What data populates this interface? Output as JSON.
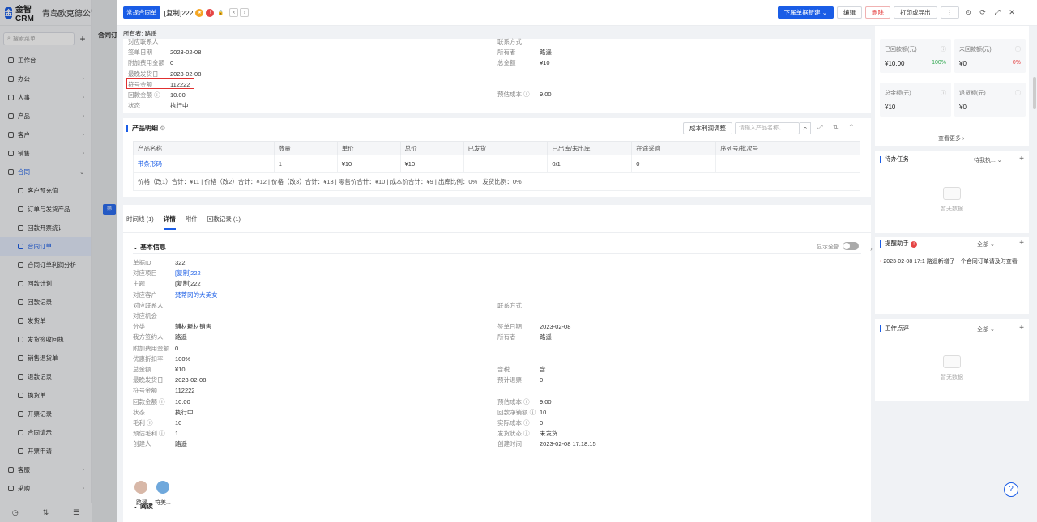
{
  "brand": {
    "logo_letter": "金",
    "name": "金智CRM",
    "company": "青岛欧克德公司"
  },
  "sidebar": {
    "search_placeholder": "搜索菜单",
    "items": [
      {
        "label": "工作台",
        "arrow": ""
      },
      {
        "label": "办公",
        "arrow": "›"
      },
      {
        "label": "人事",
        "arrow": "›"
      },
      {
        "label": "产品",
        "arrow": "›"
      },
      {
        "label": "客户",
        "arrow": "›"
      },
      {
        "label": "销售",
        "arrow": "›"
      },
      {
        "label": "合同",
        "arrow": "⌄"
      }
    ],
    "subitems": [
      "客户预充值",
      "订单与发货产品",
      "回款开票统计",
      "合同订单",
      "合同订单利润分析",
      "回款计划",
      "回款记录",
      "发货单",
      "发货签收回执",
      "销售退货单",
      "退款记录",
      "换货单",
      "开票记录",
      "合同请示",
      "开票申请"
    ],
    "active_index": 3,
    "bottom_items": [
      {
        "label": "客服",
        "arrow": "›"
      },
      {
        "label": "采购",
        "arrow": "›"
      }
    ],
    "bottom_icons": [
      "◷",
      "⇅",
      "☰"
    ]
  },
  "strip": {
    "title": "合同订",
    "button": "筛"
  },
  "topbar": {
    "tag": "常规合同单",
    "title": "[复制]222",
    "buttons": {
      "new_sub": "下属单据新建",
      "edit": "编辑",
      "delete": "删除",
      "print": "打印或导出",
      "more": "⋮"
    },
    "icons": [
      "⊙",
      "⟳",
      "⤢",
      "✕"
    ]
  },
  "owner": "所有者: 路遥",
  "top_card": {
    "left": [
      {
        "k": "对应联系人",
        "v": ""
      },
      {
        "k": "签单日期",
        "v": "2023-02-08"
      },
      {
        "k": "附加费用金额",
        "v": "0"
      },
      {
        "k": "最晚发货日",
        "v": "2023-02-08"
      },
      {
        "k": "符号金额",
        "v": "112222"
      },
      {
        "k": "回款金额 ⓘ",
        "v": "10.00"
      },
      {
        "k": "状态",
        "v": "执行中"
      }
    ],
    "right": [
      {
        "k": "联系方式",
        "v": ""
      },
      {
        "k": "所有者",
        "v": "路遥"
      },
      {
        "k": "总金额",
        "v": "¥10"
      },
      {
        "k": "预估成本 ⓘ",
        "v": "9.00"
      }
    ]
  },
  "products": {
    "title": "产品明细",
    "profit_button": "成本利润调整",
    "search_placeholder": "请输入产品名称、...",
    "headers": [
      "产品名称",
      "数量",
      "单价",
      "总价",
      "已发货",
      "已出库/未出库",
      "在途采购",
      "序列号/批次号"
    ],
    "rows": [
      [
        "带条形码",
        "1",
        "¥10",
        "¥10",
        "",
        "0/1",
        "0",
        ""
      ]
    ],
    "summary": "价格（改1）合计：¥11 | 价格（改2）合计：¥12 | 价格（改3）合计：¥13 | 零售价合计：¥10 | 成本价合计：¥9 | 出库比例：0% | 发货比例：0%"
  },
  "tabs": [
    "时间线 (1)",
    "详情",
    "附件",
    "回款记录 (1)"
  ],
  "active_tab": 1,
  "basic": {
    "title": "基本信息",
    "show_all": "显示全部",
    "rows": [
      {
        "k": "单据ID",
        "v": "322",
        "rk": "",
        "rv": ""
      },
      {
        "k": "对应项目",
        "v": "[复制]222",
        "link": true,
        "rk": "",
        "rv": ""
      },
      {
        "k": "主题",
        "v": "[复制]222",
        "rk": "",
        "rv": ""
      },
      {
        "k": "对应客户",
        "v": "梵蒂冈的大美女",
        "link": true,
        "rk": "",
        "rv": ""
      },
      {
        "k": "对应联系人",
        "v": "",
        "rk": "联系方式",
        "rv": ""
      },
      {
        "k": "对应机会",
        "v": "",
        "rk": "",
        "rv": ""
      },
      {
        "k": "分类",
        "v": "辅材耗材销售",
        "rk": "签单日期",
        "rv": "2023-02-08"
      },
      {
        "k": "我方签约人",
        "v": "路遥",
        "rk": "所有者",
        "rv": "路遥"
      },
      {
        "k": "附加费用金额",
        "v": "0",
        "rk": "",
        "rv": ""
      },
      {
        "k": "优惠折扣率",
        "v": "100%",
        "rk": "",
        "rv": ""
      },
      {
        "k": "总金额",
        "v": "¥10",
        "rk": "含税",
        "rv": "含"
      },
      {
        "k": "最晚发货日",
        "v": "2023-02-08",
        "rk": "预计退票",
        "rv": "0"
      },
      {
        "k": "符号金额",
        "v": "112222",
        "rk": "",
        "rv": ""
      },
      {
        "k": "回款金额 ⓘ",
        "v": "10.00",
        "rk": "预估成本 ⓘ",
        "rv": "9.00"
      },
      {
        "k": "状态",
        "v": "执行中",
        "rk": "回款净销额 ⓘ",
        "rv": "10"
      },
      {
        "k": "毛利 ⓘ",
        "v": "10",
        "rk": "实际成本 ⓘ",
        "rv": "0"
      },
      {
        "k": "预估毛利 ⓘ",
        "v": "1",
        "rk": "发货状态 ⓘ",
        "rv": "未发货"
      },
      {
        "k": "创建人",
        "v": "路遥",
        "rk": "创建时间",
        "rv": "2023-02-08 17:18:15"
      }
    ]
  },
  "readers": {
    "title": "阅读",
    "people": [
      "路遥",
      "符美..."
    ]
  },
  "right": {
    "stats": [
      {
        "lbl": "已回款额(元)",
        "val": "¥10.00",
        "pct": "100%",
        "color": "#2fa84f"
      },
      {
        "lbl": "未回款额(元)",
        "val": "¥0",
        "pct": "0%",
        "color": "#e54545"
      },
      {
        "lbl": "总金额(元)",
        "val": "¥10",
        "pct": "",
        "color": ""
      },
      {
        "lbl": "退货额(元)",
        "val": "¥0",
        "pct": "",
        "color": ""
      }
    ],
    "more": "查看更多 ›",
    "todo": {
      "title": "待办任务",
      "filter": "待我执... ⌄",
      "empty": "暂无数据"
    },
    "reminder": {
      "title": "提醒助手",
      "filter": "全部 ⌄",
      "item": "2023-02-08 17:1  路遥新增了一个合同订单请及时查看"
    },
    "review": {
      "title": "工作点评",
      "filter": "全部 ⌄",
      "empty": "暂无数据"
    }
  },
  "colors": {
    "accent": "#1a5de6",
    "danger": "#e54545",
    "success": "#2fa84f"
  }
}
